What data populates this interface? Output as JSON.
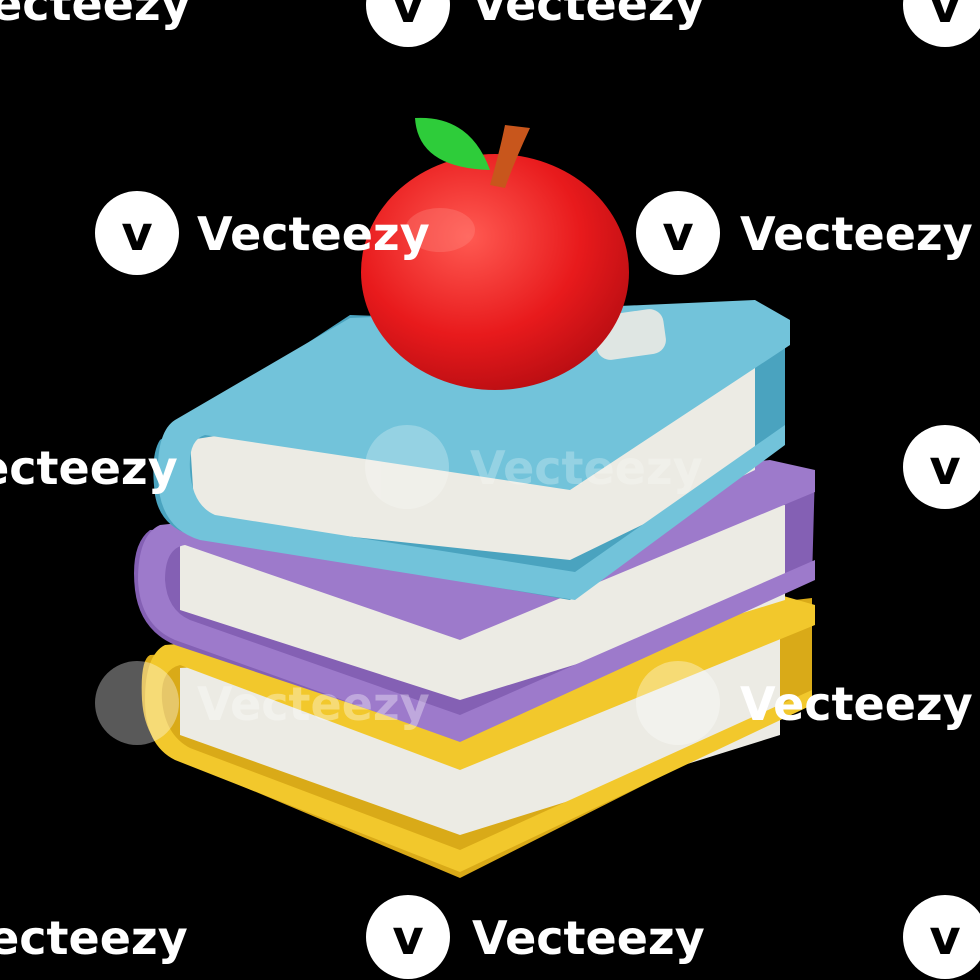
{
  "image": {
    "subject": "stack of books with apple",
    "background": "#000000",
    "colors": {
      "apple": "#e8201f",
      "leaf": "#2ecc3a",
      "stem": "#c8561c",
      "blue_book": "#6fc0d8",
      "purple_book": "#9b78c8",
      "yellow_book": "#f0c62a",
      "pages": "#ecebe4"
    }
  },
  "watermark": {
    "text": "Vecteezy",
    "logo_letter": "v"
  }
}
